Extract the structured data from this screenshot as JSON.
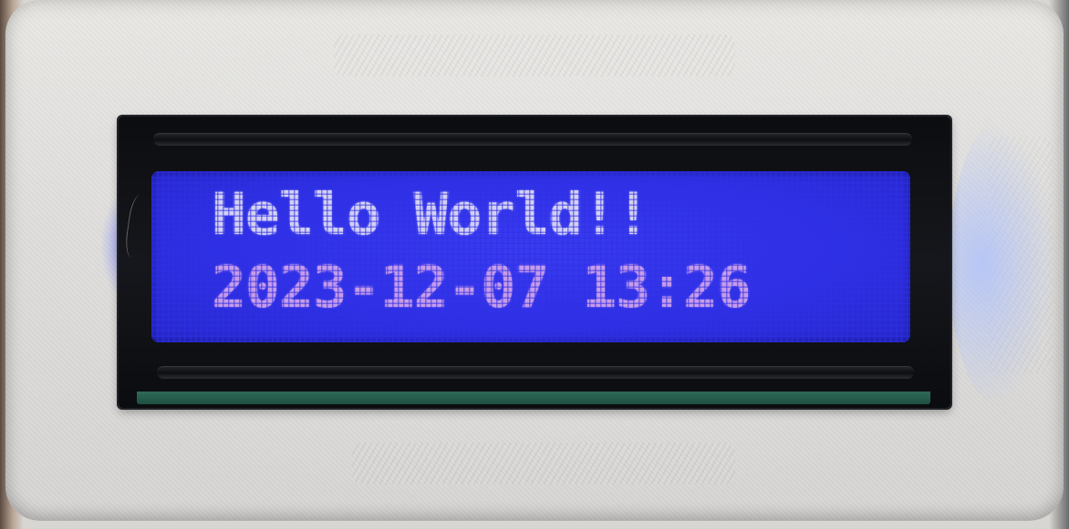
{
  "display": {
    "line1": "Hello World!!",
    "line2": "2023-12-07 13:26",
    "backlight_color": "#2f30e6",
    "text_color_line1": "#d3d0f3",
    "text_color_line2": "#c69be8"
  },
  "enclosure": {
    "color": "#dedddb"
  }
}
